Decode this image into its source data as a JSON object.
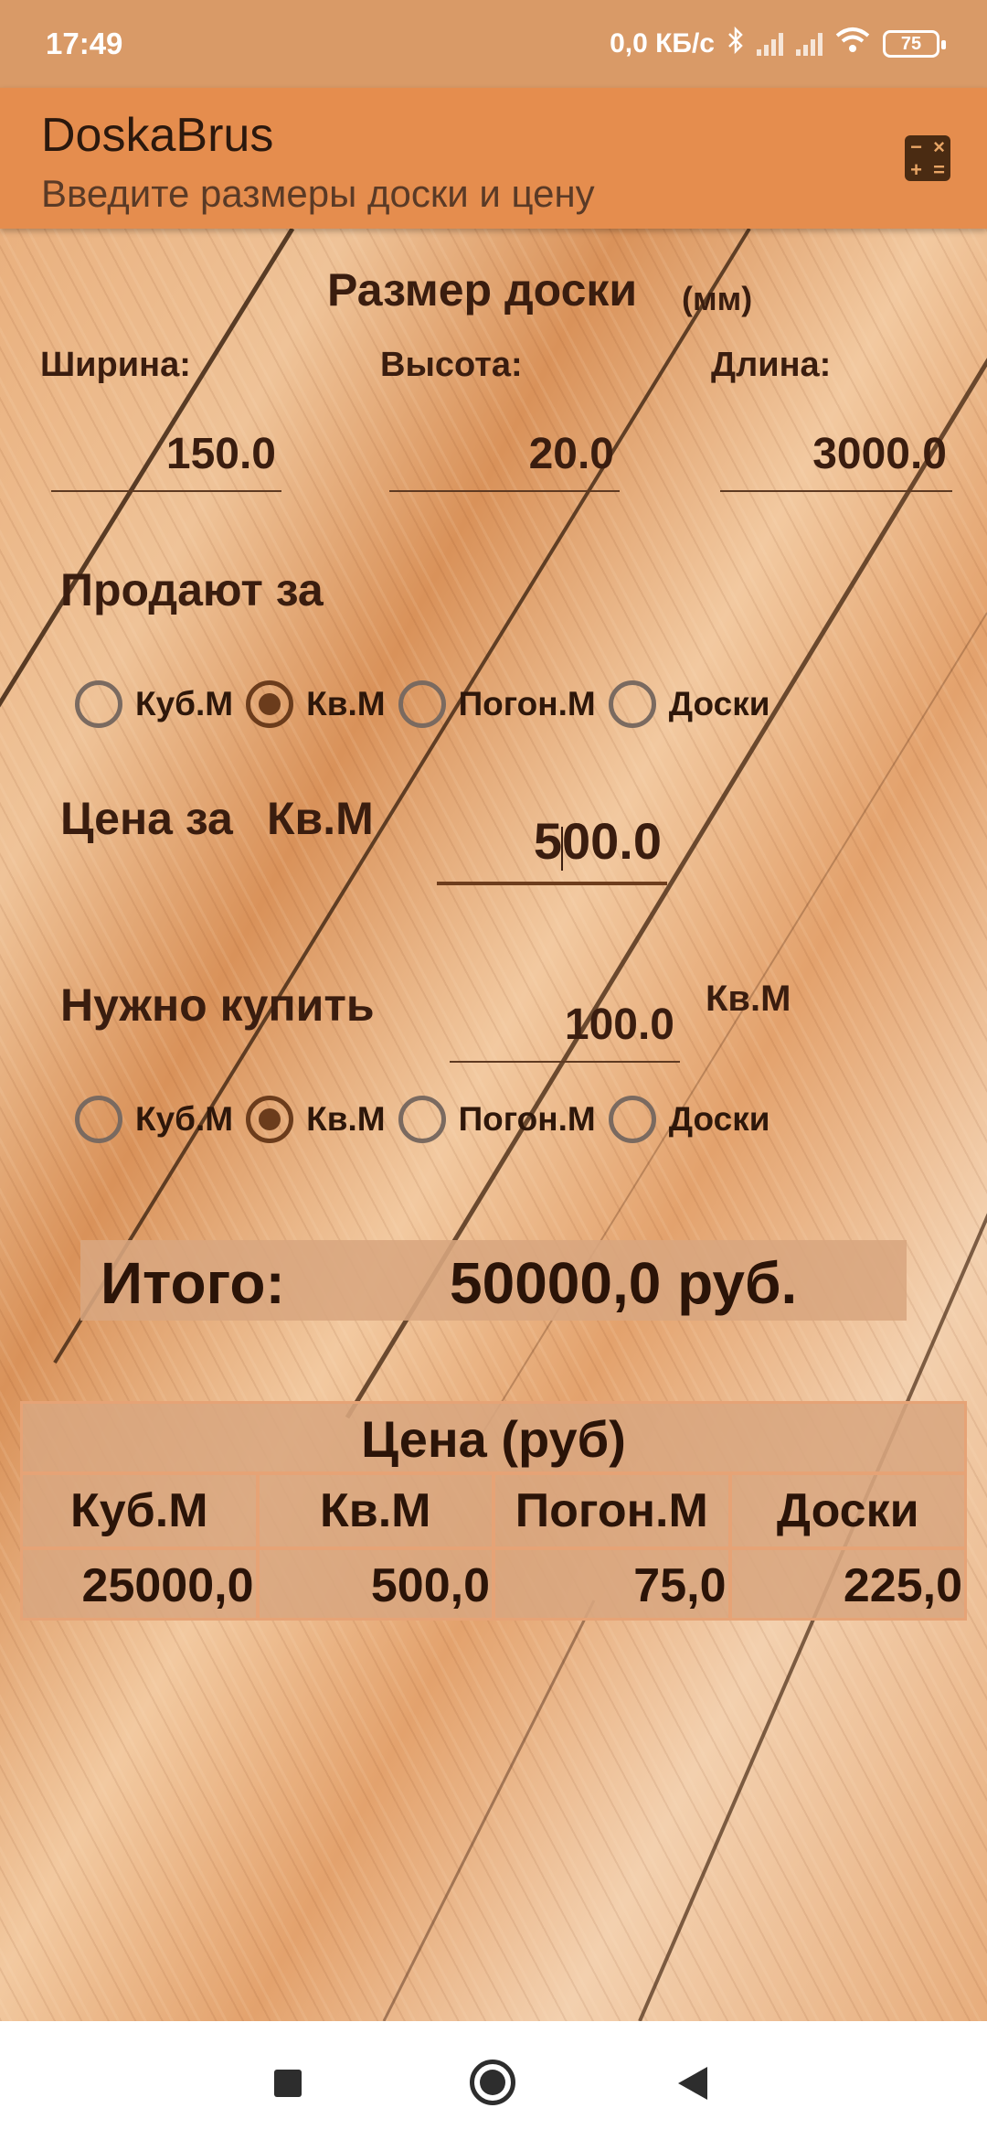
{
  "status_bar": {
    "time": "17:49",
    "network_speed": "0,0 КБ/с",
    "battery": "75"
  },
  "app_bar": {
    "title": "DoskaBrus",
    "subtitle": "Введите размеры доски и цену"
  },
  "board_size": {
    "title": "Размер доски",
    "unit": "(мм)",
    "width_label": "Ширина:",
    "height_label": "Высота:",
    "length_label": "Длина:",
    "width_value": "150.0",
    "height_value": "20.0",
    "length_value": "3000.0"
  },
  "sold_by": {
    "label": "Продают за",
    "options": [
      "Куб.М",
      "Кв.М",
      "Погон.М",
      "Доски"
    ],
    "selected": "Кв.М"
  },
  "price": {
    "label": "Цена за",
    "unit": "Кв.М",
    "value_before_cursor": "5",
    "value_after_cursor": "00.0"
  },
  "need_buy": {
    "label": "Нужно купить",
    "value": "100.0",
    "unit": "Кв.М",
    "options": [
      "Куб.М",
      "Кв.М",
      "Погон.М",
      "Доски"
    ],
    "selected": "Кв.М"
  },
  "total": {
    "label": "Итого:",
    "value": "50000,0 руб."
  },
  "price_table": {
    "title": "Цена (руб)",
    "headers": [
      "Куб.М",
      "Кв.М",
      "Погон.М",
      "Доски"
    ],
    "values": [
      "25000,0",
      "500,0",
      "75,0",
      "225,0"
    ]
  },
  "colors": {
    "status_bar": "#d99a67",
    "app_bar": "#e58d4e",
    "text": "#3a1d0f",
    "panel": "#d8a680"
  },
  "icons": [
    "bluetooth-icon",
    "signal-icon",
    "wifi-icon",
    "battery-icon",
    "calculator-icon",
    "radio-button-icon",
    "recents-icon",
    "home-icon",
    "back-icon"
  ]
}
